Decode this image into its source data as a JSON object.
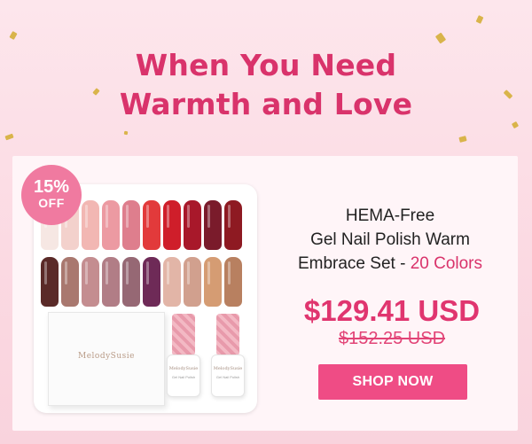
{
  "headline": {
    "line1": "When You Need",
    "line2": "Warmth and Love"
  },
  "badge": {
    "percent": "15%",
    "label": "OFF"
  },
  "product": {
    "title_line1": "HEMA-Free",
    "title_line2": "Gel Nail Polish Warm",
    "title_line3": "Embrace Set - ",
    "title_accent": "20 Colors",
    "box_brand": "MelodySusie",
    "jar_brand": "MelodySusie",
    "jar_sub": "Gel Nail Polish",
    "swatches_row1": [
      "#f6e7e3",
      "#f3d1cc",
      "#f2b7b3",
      "#ec9aa2",
      "#de7e8d",
      "#e23a3b",
      "#cf1e2a",
      "#a8182a",
      "#7a1b2b",
      "#8e1a22"
    ],
    "swatches_row2": [
      "#5a2a28",
      "#a9786f",
      "#c48d90",
      "#b17d86",
      "#966874",
      "#6e2a57",
      "#e2b5a7",
      "#d1a08e",
      "#d59c73",
      "#b88060"
    ]
  },
  "pricing": {
    "price": "$129.41 USD",
    "original_price": "$152.25 USD"
  },
  "cta": {
    "label": "SHOP NOW"
  },
  "colors": {
    "accent": "#d9336b",
    "button": "#ef4c85",
    "badge": "#f07aa0",
    "confetti": "#d9b44a"
  }
}
